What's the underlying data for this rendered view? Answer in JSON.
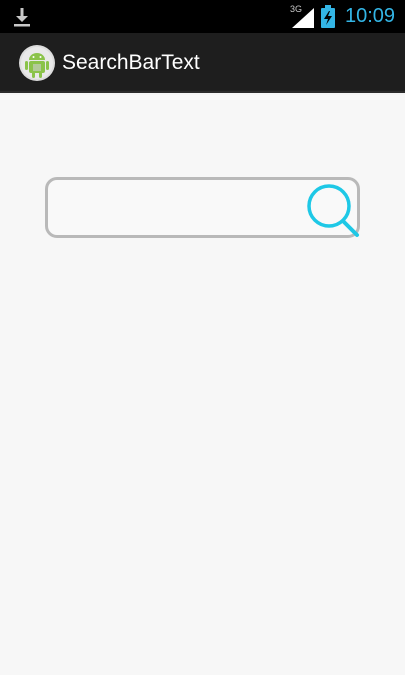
{
  "status_bar": {
    "network": "3G",
    "time": "10:09",
    "icons": [
      "download-icon",
      "signal-icon",
      "battery-charging-icon"
    ]
  },
  "action_bar": {
    "app_icon": "android-icon",
    "title": "SearchBarText"
  },
  "search": {
    "value": "",
    "placeholder": "",
    "icon": "search-icon"
  },
  "colors": {
    "status_bar_bg": "#000000",
    "clock": "#33b5e5",
    "action_bar_bg": "#1e1e1e",
    "content_bg": "#f7f7f7",
    "search_border": "#b9b9b9",
    "search_icon": "#1ec8e6",
    "android_green": "#8bc34a"
  }
}
